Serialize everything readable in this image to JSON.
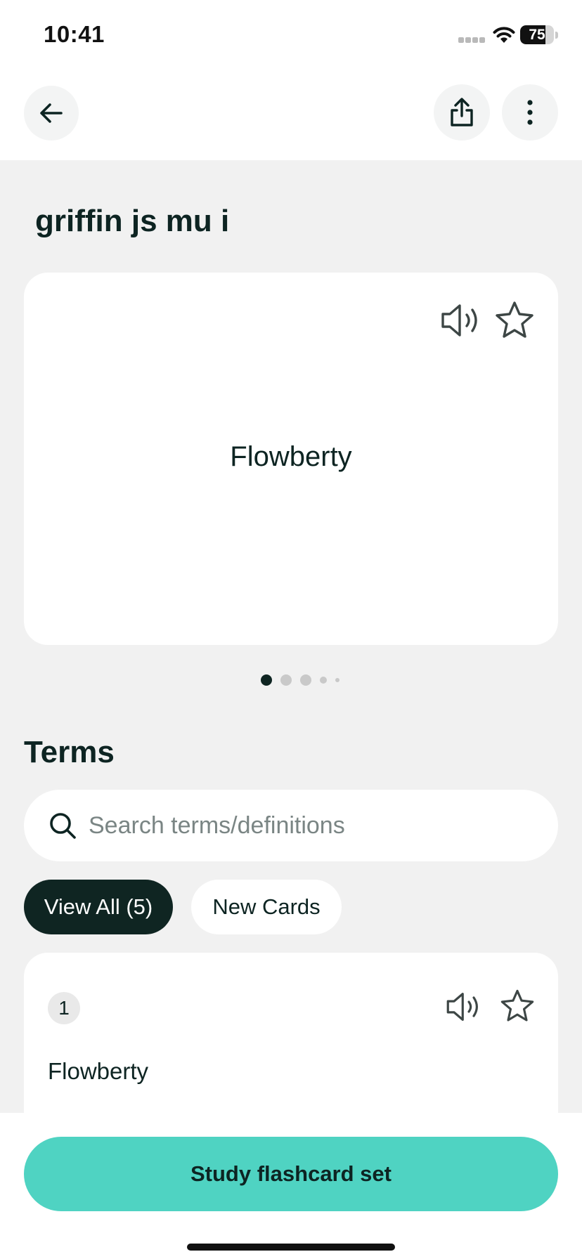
{
  "status_bar": {
    "time": "10:41",
    "battery_percent": 75,
    "battery_label": "75"
  },
  "toolbar": {
    "back_icon": "arrow-left-icon",
    "share_icon": "share-icon",
    "more_icon": "more-vertical-icon"
  },
  "deck": {
    "title": "griffin js mu i"
  },
  "flashcard": {
    "term": "Flowberty",
    "audio_icon": "speaker-icon",
    "star_icon": "star-icon"
  },
  "pager": {
    "total": 5,
    "active_index": 0
  },
  "terms": {
    "heading": "Terms",
    "search_placeholder": "Search terms/definitions",
    "filters": [
      {
        "label": "View All (5)",
        "selected": true
      },
      {
        "label": "New Cards",
        "selected": false
      }
    ],
    "items": [
      {
        "number": "1",
        "term": "Flowberty"
      }
    ]
  },
  "footer": {
    "study_label": "Study flashcard set"
  },
  "colors": {
    "accent": "#4fd3c2",
    "dark": "#0f2522",
    "background": "#f1f1f1"
  }
}
